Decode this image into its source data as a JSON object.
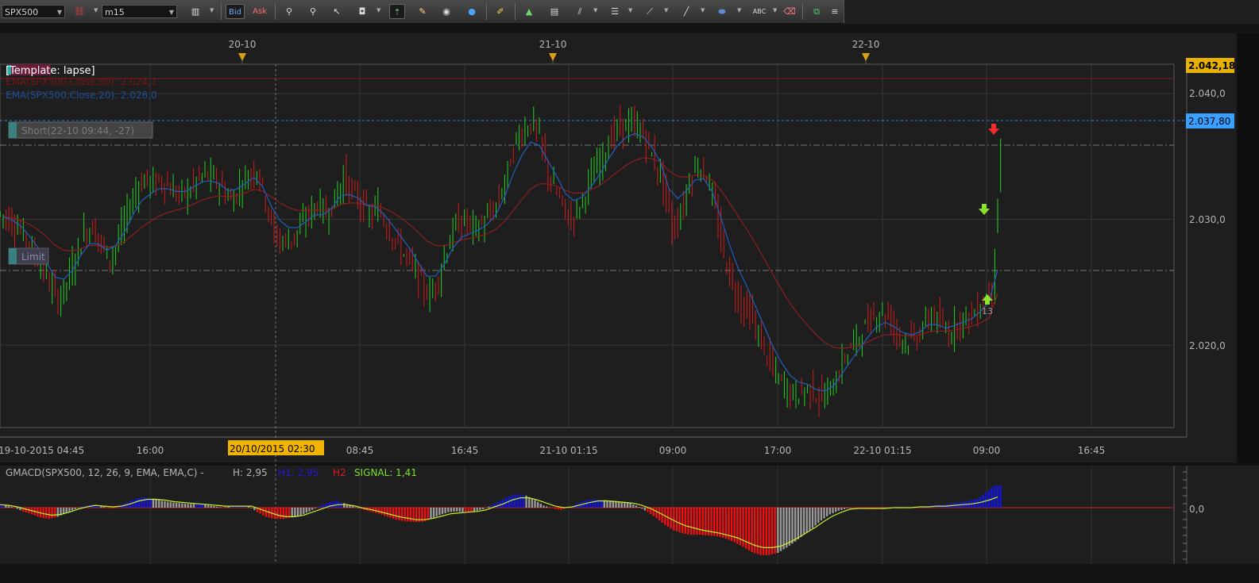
{
  "toolbar": {
    "symbol": "SPX500",
    "timeframe": "m15",
    "bid_label": "Bid",
    "ask_label": "Ask"
  },
  "chart": {
    "template_label": "[Template: lapse]",
    "ema80_label": "EMA(SPX500,Close,80): 2.024,1",
    "ema20_label": "EMA(SPX500,Close,20): 2.026,0",
    "short_order_label": "Short(22-10 09:44, -27)",
    "limit_order_label": "Limit",
    "signal_count": "13",
    "price_labels": [
      "2.040,0",
      "2.030,0",
      "2.020,0"
    ],
    "top_price_tag": "2.042,18",
    "current_price_tag": "2.037,80",
    "date_markers": [
      "20-10",
      "21-10",
      "22-10"
    ],
    "time_labels": [
      "19-10-2015 04:45",
      "16:00",
      "08:45",
      "16:45",
      "21-10 01:15",
      "09:00",
      "17:00",
      "22-10 01:15",
      "09:00",
      "16:45"
    ],
    "crosshair_time": "20/10/2015 02:30"
  },
  "indicator": {
    "title": "GMACD(SPX500, 12, 26, 9, EMA, EMA,C) -",
    "h_label": "H: 2,95",
    "h1_label": "H1: 2,95",
    "h2_label": "H2",
    "signal_label": "SIGNAL: 1,41",
    "zero_label": "0,0"
  },
  "chart_data": {
    "type": "candlestick",
    "symbol": "SPX500",
    "timeframe": "m15",
    "price_axis_ticks": [
      2020.0,
      2030.0,
      2040.0
    ],
    "price_range": [
      2013.0,
      2043.0
    ],
    "top_price": 2042.18,
    "current_price": 2037.8,
    "limit_price": 2025.9,
    "short_level": 2035.8,
    "ema20_last": 2026.0,
    "ema80_last": 2024.1,
    "close_series": [
      2030.2,
      2029.6,
      2028.8,
      2027.5,
      2026.4,
      2024.8,
      2023.6,
      2025.0,
      2027.0,
      2029.0,
      2029.4,
      2028.0,
      2026.8,
      2028.5,
      2030.5,
      2032.4,
      2033.2,
      2032.8,
      2033.1,
      2032.4,
      2031.9,
      2032.2,
      2033.1,
      2033.6,
      2033.2,
      2032.5,
      2031.4,
      2032.6,
      2033.5,
      2034.1,
      2031.5,
      2028.7,
      2028.2,
      2028.5,
      2029.3,
      2030.5,
      2031.2,
      2030.4,
      2031.6,
      2033.4,
      2032.1,
      2031.3,
      2030.2,
      2030.9,
      2029.5,
      2028.3,
      2027.2,
      2026.3,
      2024.8,
      2023.9,
      2025.5,
      2027.8,
      2029.6,
      2029.9,
      2029.3,
      2029.6,
      2030.3,
      2031.6,
      2033.9,
      2036.4,
      2037.3,
      2037.7,
      2035.5,
      2032.8,
      2031.6,
      2030.0,
      2030.6,
      2032.3,
      2033.8,
      2035.1,
      2036.6,
      2037.4,
      2037.5,
      2037.3,
      2036.2,
      2034.5,
      2032.8,
      2029.2,
      2030.5,
      2033.2,
      2034.4,
      2033.4,
      2030.6,
      2027.1,
      2024.7,
      2023.3,
      2022.5,
      2020.7,
      2019.1,
      2017.5,
      2016.7,
      2016.0,
      2016.3,
      2016.6,
      2015.8,
      2016.2,
      2017.3,
      2019.2,
      2020.2,
      2021.1,
      2022.1,
      2022.7,
      2022.3,
      2021.0,
      2020.3,
      2020.5,
      2021.4,
      2022.5,
      2021.6,
      2020.9,
      2021.9,
      2022.2,
      2022.5,
      2023.5,
      2024.6,
      2035.5
    ],
    "macd_histogram": [
      0.4,
      0.3,
      0.0,
      -0.5,
      -0.9,
      -1.3,
      -1.5,
      -1.2,
      -0.7,
      -0.2,
      0.2,
      0.4,
      0.2,
      -0.1,
      0.2,
      0.7,
      1.2,
      1.4,
      1.2,
      0.9,
      0.7,
      0.6,
      0.5,
      0.5,
      0.4,
      0.2,
      0.0,
      0.2,
      0.3,
      0.2,
      -0.6,
      -1.2,
      -1.5,
      -1.5,
      -1.3,
      -1.0,
      -0.5,
      0.1,
      0.6,
      0.9,
      0.6,
      0.2,
      -0.2,
      -0.5,
      -0.8,
      -1.2,
      -1.6,
      -1.8,
      -1.9,
      -1.9,
      -1.5,
      -1.0,
      -0.6,
      -0.5,
      -0.6,
      -0.5,
      -0.2,
      0.3,
      0.9,
      1.5,
      1.8,
      1.6,
      1.0,
      0.3,
      -0.1,
      -0.3,
      0.1,
      0.6,
      1.0,
      1.1,
      1.0,
      0.9,
      0.8,
      0.6,
      0.1,
      -0.6,
      -1.4,
      -2.3,
      -3.0,
      -3.4,
      -3.6,
      -3.6,
      -3.7,
      -3.8,
      -4.1,
      -4.6,
      -5.2,
      -5.9,
      -6.3,
      -6.3,
      -6.0,
      -5.3,
      -4.5,
      -3.6,
      -2.7,
      -1.7,
      -0.9,
      -0.4,
      -0.1,
      0.0,
      -0.1,
      -0.2,
      -0.1,
      0.0,
      -0.1,
      0.0,
      0.1,
      0.2,
      0.3,
      0.4,
      0.6,
      0.7,
      0.9,
      1.2,
      2.0,
      2.95
    ],
    "macd_signal": [
      0.4,
      0.3,
      0.1,
      -0.2,
      -0.5,
      -0.8,
      -1.0,
      -0.9,
      -0.6,
      -0.2,
      0.1,
      0.3,
      0.2,
      0.1,
      0.2,
      0.5,
      0.9,
      1.1,
      1.1,
      1.0,
      0.8,
      0.7,
      0.6,
      0.5,
      0.4,
      0.3,
      0.2,
      0.2,
      0.2,
      0.2,
      -0.2,
      -0.6,
      -1.0,
      -1.2,
      -1.2,
      -1.0,
      -0.6,
      -0.2,
      0.2,
      0.4,
      0.4,
      0.2,
      -0.1,
      -0.3,
      -0.6,
      -0.9,
      -1.2,
      -1.4,
      -1.6,
      -1.6,
      -1.4,
      -1.1,
      -0.8,
      -0.7,
      -0.6,
      -0.5,
      -0.3,
      0.1,
      0.5,
      1.0,
      1.3,
      1.3,
      1.0,
      0.6,
      0.2,
      0.0,
      0.1,
      0.4,
      0.7,
      0.9,
      0.9,
      0.8,
      0.7,
      0.6,
      0.3,
      -0.1,
      -0.7,
      -1.3,
      -1.9,
      -2.4,
      -2.7,
      -3.0,
      -3.2,
      -3.4,
      -3.7,
      -4.0,
      -4.5,
      -5.0,
      -5.3,
      -5.3,
      -5.1,
      -4.6,
      -4.0,
      -3.3,
      -2.6,
      -1.8,
      -1.1,
      -0.6,
      -0.2,
      -0.1,
      -0.1,
      -0.1,
      -0.1,
      0.0,
      0.0,
      0.0,
      0.1,
      0.1,
      0.2,
      0.2,
      0.3,
      0.4,
      0.5,
      0.7,
      1.0,
      1.41
    ]
  },
  "colors": {
    "background": "#1e1e1e",
    "bull_candle": "#22c122",
    "bear_candle": "#c11b1b",
    "ema20": "#1f5fbf",
    "ema80": "#8b1f1f",
    "macd_positive": "#1515e0",
    "macd_negative": "#ee1111",
    "macd_fading": "#9a9a9a",
    "signal_line": "#c4f02a",
    "price_tag_top": "#e8b000",
    "price_tag_current": "#3aa0ff",
    "crosshair_tag": "#f0b400"
  }
}
